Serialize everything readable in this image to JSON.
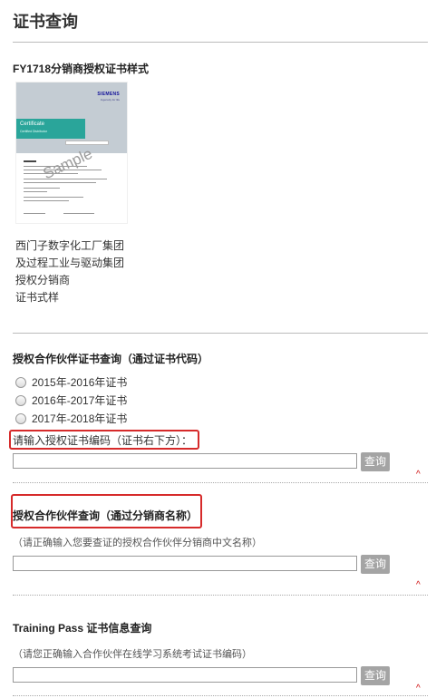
{
  "page_title": "证书查询",
  "sample_section": {
    "title": "FY1718分销商授权证书样式",
    "certificate": {
      "brand": "SIEMENS",
      "tagline": "Ingenuity for life",
      "heading": "Certificate",
      "subheading": "Certified Distributor",
      "watermark": "Sample"
    },
    "description": [
      "西门子数字化工厂集团",
      "及过程工业与驱动集团",
      "授权分销商",
      "证书式样"
    ]
  },
  "code_section": {
    "title": "授权合作伙伴证书查询（通过证书代码）",
    "options": [
      "2015年-2016年证书",
      "2016年-2017年证书",
      "2017年-2018年证书"
    ],
    "input_label": "请输入授权证书编码（证书右下方）：",
    "button": "查询",
    "caret": "^"
  },
  "name_section": {
    "title": "授权合作伙伴查询（通过分销商名称）",
    "hint": "（请正确输入您要查证的授权合作伙伴分销商中文名称）",
    "button": "查询",
    "caret": "^"
  },
  "training_section": {
    "title": "Training Pass 证书信息查询",
    "hint": "（请您正确输入合作伙伴在线学习系统考试证书编码）",
    "button": "查询",
    "caret": "^"
  },
  "colors": {
    "highlight_border": "#d62a2a",
    "button_bg": "#a4a4a4",
    "cert_teal": "#2aa59a"
  }
}
